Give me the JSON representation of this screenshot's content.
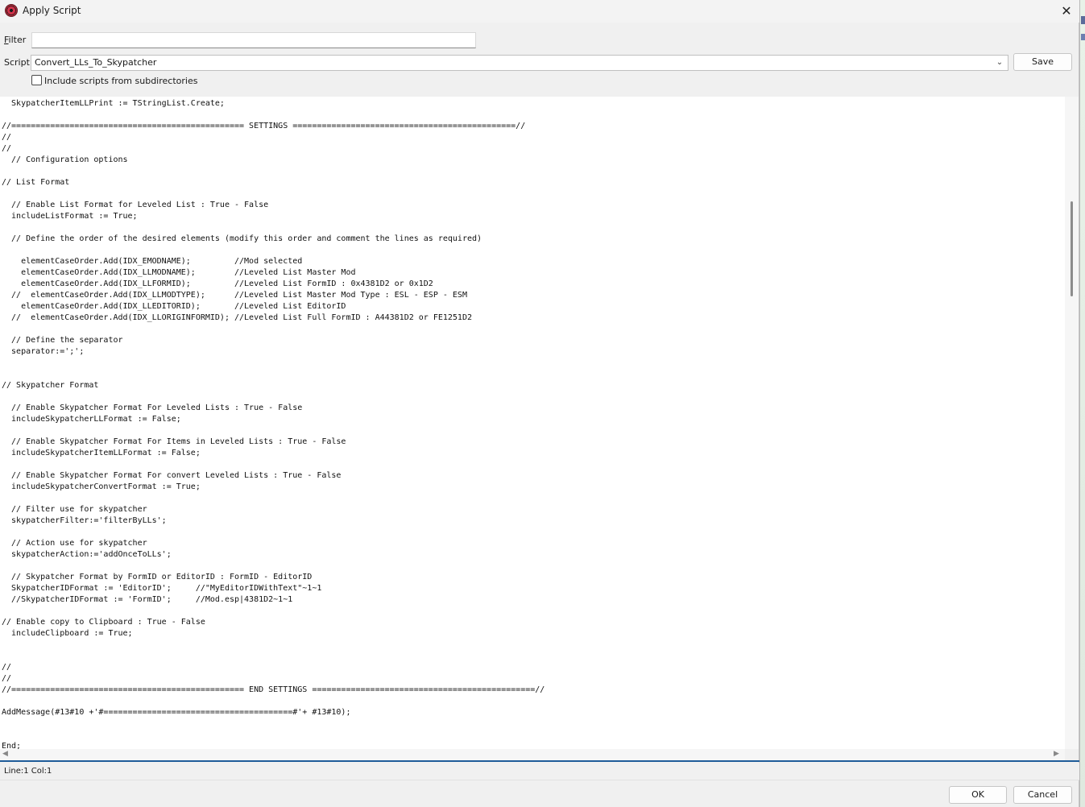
{
  "window": {
    "title": "Apply Script",
    "close_glyph": "✕"
  },
  "filter": {
    "label_accel": "F",
    "label_rest": "ilter",
    "value": ""
  },
  "script": {
    "label": "Script",
    "selected": "Convert_LLs_To_Skypatcher",
    "save_label": "Save"
  },
  "options": {
    "include_subdirs_label": "Include scripts from subdirectories",
    "include_subdirs_checked": false
  },
  "editor": {
    "lines": [
      "  SkypatcherItemLLPrint := TStringList.Create;",
      "",
      "//================================================ SETTINGS ==============================================//",
      "//",
      "//",
      "  // Configuration options",
      "",
      "// List Format",
      "",
      "  // Enable List Format for Leveled List : True - False",
      "  includeListFormat := True;",
      "",
      "  // Define the order of the desired elements (modify this order and comment the lines as required)",
      "",
      "    elementCaseOrder.Add(IDX_EMODNAME);         //Mod selected",
      "    elementCaseOrder.Add(IDX_LLMODNAME);        //Leveled List Master Mod",
      "    elementCaseOrder.Add(IDX_LLFORMID);         //Leveled List FormID : 0x4381D2 or 0x1D2",
      "  //  elementCaseOrder.Add(IDX_LLMODTYPE);      //Leveled List Master Mod Type : ESL - ESP - ESM",
      "    elementCaseOrder.Add(IDX_LLEDITORID);       //Leveled List EditorID",
      "  //  elementCaseOrder.Add(IDX_LLORIGINFORMID); //Leveled List Full FormID : A44381D2 or FE1251D2",
      "",
      "  // Define the separator",
      "  separator:=';';",
      "",
      "",
      "// Skypatcher Format",
      "",
      "  // Enable Skypatcher Format For Leveled Lists : True - False",
      "  includeSkypatcherLLFormat := False;",
      "",
      "  // Enable Skypatcher Format For Items in Leveled Lists : True - False",
      "  includeSkypatcherItemLLFormat := False;",
      "",
      "  // Enable Skypatcher Format For convert Leveled Lists : True - False",
      "  includeSkypatcherConvertFormat := True;",
      "",
      "  // Filter use for skypatcher",
      "  skypatcherFilter:='filterByLLs';",
      "",
      "  // Action use for skypatcher",
      "  skypatcherAction:='addOnceToLLs';",
      "",
      "  // Skypatcher Format by FormID or EditorID : FormID - EditorID",
      "  SkypatcherIDFormat := 'EditorID';     //\"MyEditorIDWithText\"~1~1",
      "  //SkypatcherIDFormat := 'FormID';     //Mod.esp|4381D2~1~1",
      "",
      "// Enable copy to Clipboard : True - False",
      "  includeClipboard := True;",
      "",
      "",
      "//",
      "//",
      "//================================================ END SETTINGS ==============================================//",
      "",
      "AddMessage(#13#10 +'#=======================================#'+ #13#10);",
      "",
      "",
      "End;"
    ]
  },
  "status": {
    "position": "Line:1 Col:1"
  },
  "buttons": {
    "ok_label": "OK",
    "cancel_label": "Cancel"
  }
}
